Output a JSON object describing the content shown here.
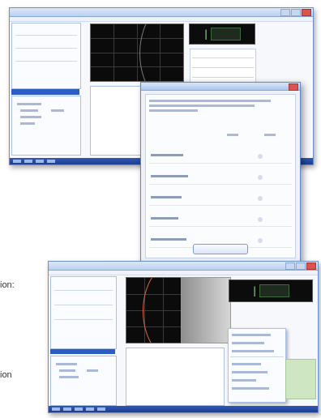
{
  "page_fragments": {
    "frag_top": "ion:",
    "frag_bottom": "ion"
  },
  "displays": {
    "top_readout": "| ",
    "bottom_readout": "| "
  },
  "colors": {
    "titlebar": "#b9cfee",
    "taskbar": "#1d3e8f",
    "scope_bg": "#0b0b0b",
    "scope_curve": "#e06a4a",
    "display_text": "#9de79d"
  },
  "icons": {
    "close": "close-icon",
    "maximize": "maximize-icon",
    "minimize": "minimize-icon"
  }
}
